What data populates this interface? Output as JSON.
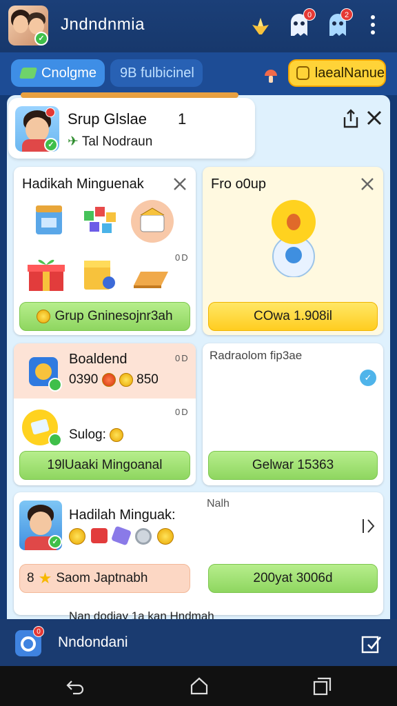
{
  "header": {
    "title": "Jndndnmia",
    "notif_badge_1": "0",
    "notif_badge_2": "2"
  },
  "tabs": [
    {
      "label": "Cnolgme"
    },
    {
      "label": "9B fulbicinel"
    },
    {
      "label": "laealNanue"
    }
  ],
  "group": {
    "name": "Srup Glslae",
    "count": "1",
    "subtitle": "Tal Nodraun"
  },
  "cards": {
    "gifts": {
      "title": "Hadikah Minguenak",
      "od": "0D",
      "button": "Grup Gninesojnr3ah"
    },
    "group_pet": {
      "title": "Fro o0up",
      "button": "COwa 1.908il"
    },
    "bonus": {
      "title": "Boaldend",
      "values": "0390",
      "amount": "850",
      "od": "0D"
    },
    "radar": {
      "title": "Radraolom fip3ae"
    },
    "sulog": {
      "label": "Sulog:",
      "od": "0D",
      "button": "19lUaaki Mingoanal"
    },
    "gelwar": {
      "button": "Gelwar 15363"
    },
    "daily": {
      "title": "Hadilah Minguak:",
      "note": "Nalh",
      "button_left": "Saom Japtnabh",
      "button_left_num": "8",
      "button_right": "200yat 3006d"
    },
    "partial": {
      "text": "Nan dodiay 1a kan Hndmah"
    }
  },
  "bottom_bar": {
    "label": "Nndondani",
    "badge": "0"
  },
  "colors": {
    "accent_blue": "#3e8ee6",
    "accent_yellow": "#ffd338",
    "button_green": "#8fd660",
    "badge_red": "#e53935"
  }
}
